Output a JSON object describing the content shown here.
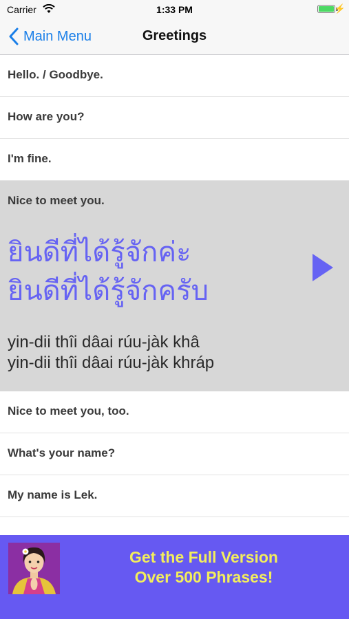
{
  "status_bar": {
    "carrier": "Carrier",
    "time": "1:33 PM"
  },
  "nav": {
    "back_label": "Main Menu",
    "title": "Greetings"
  },
  "phrases": [
    {
      "english": "Hello. / Goodbye."
    },
    {
      "english": "How are you?"
    },
    {
      "english": "I'm fine."
    },
    {
      "english": "Nice to meet you.",
      "thai": [
        "ยินดีที่ได้รู้จักค่ะ",
        "ยินดีที่ได้รู้จักครับ"
      ],
      "romanization": [
        "yin-dii thîi dâai rúu-jàk khâ",
        "yin-dii thîi dâai rúu-jàk khráp"
      ]
    },
    {
      "english": "Nice to meet you, too."
    },
    {
      "english": "What's your name?"
    },
    {
      "english": "My name is Lek."
    }
  ],
  "banner": {
    "line1": "Get the Full Version",
    "line2": "Over 500 Phrases!"
  },
  "colors": {
    "accent": "#1a7fe8",
    "thai_text": "#6663f3",
    "banner_bg": "#6659f2",
    "banner_text": "#f3ee5c",
    "expanded_row": "#d7d7d7"
  },
  "icons": [
    "wifi-icon",
    "battery-icon",
    "charging-icon",
    "back-chevron-icon",
    "play-icon",
    "avatar-image"
  ]
}
